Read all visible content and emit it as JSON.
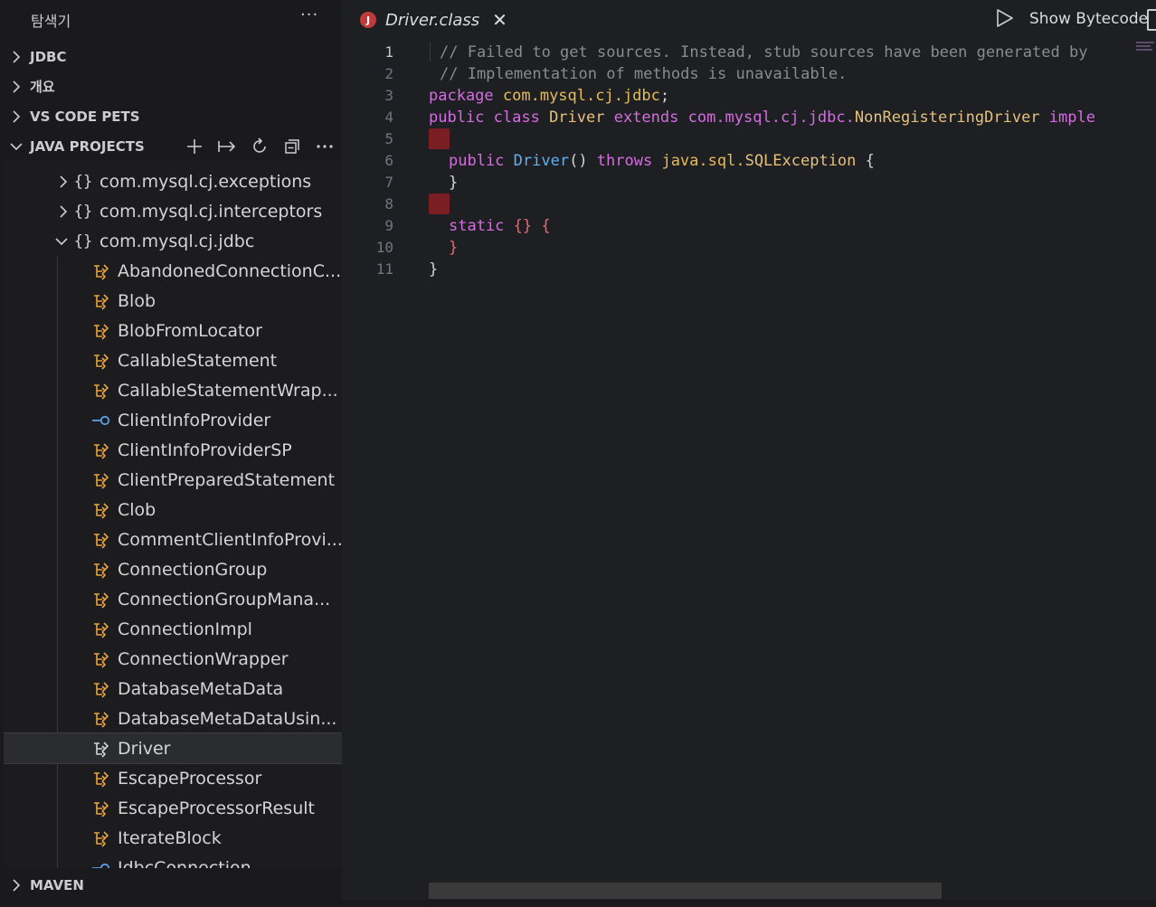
{
  "sidebar": {
    "title": "탐색기",
    "more": "···",
    "sections": {
      "jdbc": "JDBC",
      "outline": "개요",
      "pets": "VS CODE PETS",
      "java_projects": "JAVA PROJECTS",
      "maven": "MAVEN"
    },
    "tree": {
      "partial_top": "",
      "packages": [
        {
          "name": "com.mysql.cj.exceptions",
          "expanded": false
        },
        {
          "name": "com.mysql.cj.interceptors",
          "expanded": false
        },
        {
          "name": "com.mysql.cj.jdbc",
          "expanded": true
        }
      ],
      "items": [
        {
          "name": "AbandonedConnectionC...",
          "kind": "class"
        },
        {
          "name": "Blob",
          "kind": "class"
        },
        {
          "name": "BlobFromLocator",
          "kind": "class"
        },
        {
          "name": "CallableStatement",
          "kind": "class"
        },
        {
          "name": "CallableStatementWrap...",
          "kind": "class"
        },
        {
          "name": "ClientInfoProvider",
          "kind": "interface"
        },
        {
          "name": "ClientInfoProviderSP",
          "kind": "class"
        },
        {
          "name": "ClientPreparedStatement",
          "kind": "class"
        },
        {
          "name": "Clob",
          "kind": "class"
        },
        {
          "name": "CommentClientInfoProvi...",
          "kind": "class"
        },
        {
          "name": "ConnectionGroup",
          "kind": "class"
        },
        {
          "name": "ConnectionGroupMana...",
          "kind": "class"
        },
        {
          "name": "ConnectionImpl",
          "kind": "class"
        },
        {
          "name": "ConnectionWrapper",
          "kind": "class"
        },
        {
          "name": "DatabaseMetaData",
          "kind": "class"
        },
        {
          "name": "DatabaseMetaDataUsin...",
          "kind": "class"
        },
        {
          "name": "Driver",
          "kind": "class",
          "selected": true
        },
        {
          "name": "EscapeProcessor",
          "kind": "class"
        },
        {
          "name": "EscapeProcessorResult",
          "kind": "class"
        },
        {
          "name": "IterateBlock",
          "kind": "class"
        },
        {
          "name": "JdbcConnection",
          "kind": "interface"
        }
      ]
    }
  },
  "editor": {
    "tab": {
      "name": "Driver.class",
      "badge": "J",
      "close": "✕"
    },
    "show_bytecode": "Show Bytecode",
    "line_numbers": [
      "1",
      "2",
      "3",
      "4",
      "5",
      "6",
      "7",
      "8",
      "9",
      "10",
      "11"
    ],
    "active_line": "1",
    "code": {
      "l1": "// Failed to get sources. Instead, stub sources have been generated by",
      "l2": "// Implementation of methods is unavailable.",
      "l3_kw": "package",
      "l3_pkg": " com.mysql.cj.jdbc",
      "l3_end": ";",
      "l4_kw1": "public class",
      "l4_cls": " Driver",
      "l4_kw2": " extends",
      "l4_pkg": " com.mysql.cj.jdbc.",
      "l4_cls2": "NonRegisteringDriver",
      "l4_kw3": " imple",
      "l6_kw": "public",
      "l6_fn": " Driver",
      "l6_par": "()",
      "l6_kw2": " throws",
      "l6_pkg": " java.sql.",
      "l6_cls": "SQLException",
      "l6_end": " {",
      "l7": "}",
      "l9_kw": "static",
      "l9_red": " {} {",
      "l10": "}",
      "l11": "}"
    }
  },
  "colors": {
    "keyword": "#d36de0",
    "package": "#e5bd58",
    "function": "#61afef",
    "comment": "#8b8b8b",
    "marker": "#7a1e24",
    "class_icon": "#e8a33d",
    "interface_icon": "#5c9ee8"
  },
  "icons": {
    "chevron_right": "chevron-right-icon",
    "chevron_down": "chevron-down-icon",
    "class": "class-icon",
    "interface": "interface-icon",
    "package": "package-icon",
    "run": "run-icon",
    "add": "add-icon",
    "link": "link-icon",
    "refresh": "refresh-icon",
    "collapse": "collapse-all-icon",
    "more": "more-icon"
  }
}
